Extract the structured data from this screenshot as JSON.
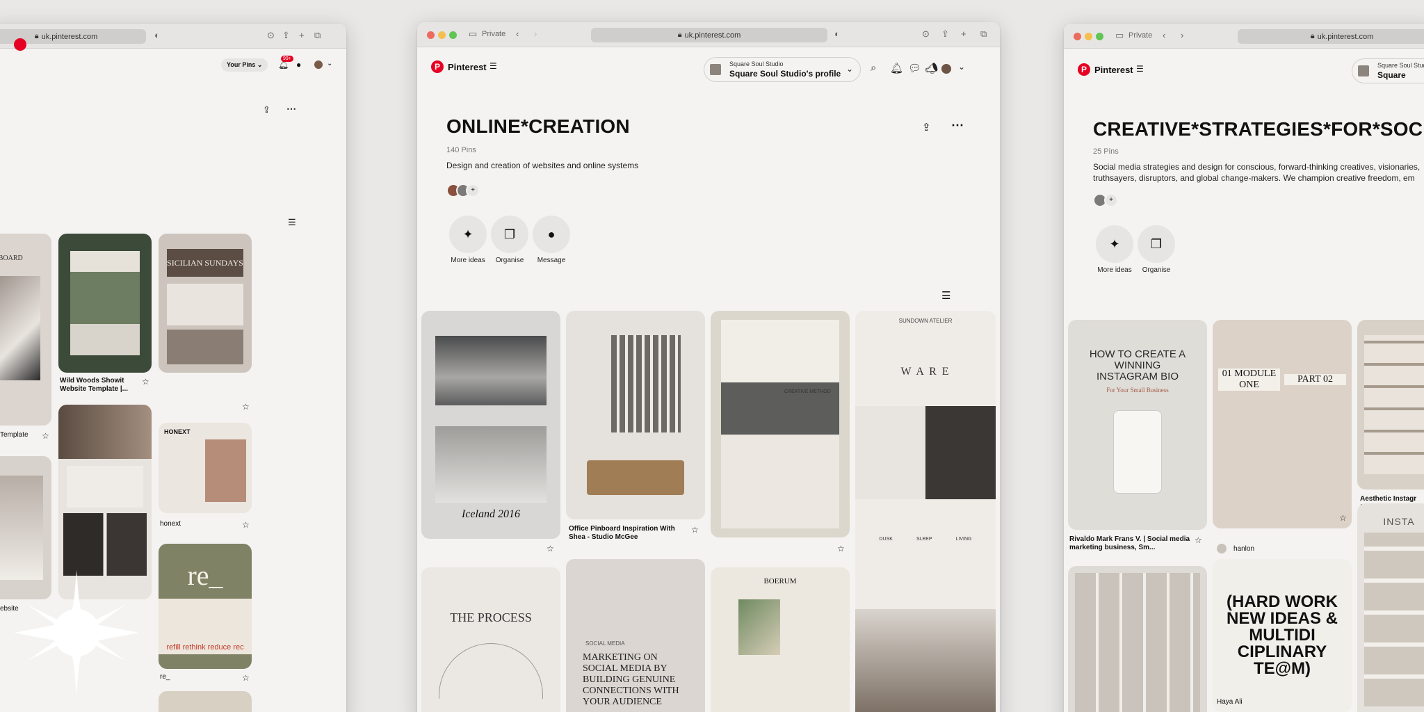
{
  "left_window": {
    "address": "uk.pinterest.com",
    "your_pins_label": "Your Pins",
    "notifications_badge": "99+",
    "captions": [
      "Wild Woods Showit Website Template |...",
      "honext",
      "re_",
      "Template",
      "ebsite"
    ],
    "card_texts": {
      "sicilian": "SICILIAN SUNDAYS",
      "board": "D BOARD",
      "honext": "HONEXT",
      "re": "re_",
      "re_tags": "refill rethink reduce rec"
    }
  },
  "center_window": {
    "private_label": "Private",
    "address": "uk.pinterest.com",
    "brand": "Pinterest",
    "profile_small": "Square Soul Studio",
    "profile_name": "Square Soul Studio's profile",
    "board_title": "ONLINE*CREATION",
    "pin_count": "140 Pins",
    "description": "Design and creation of websites and online systems",
    "actions": [
      {
        "label": "More ideas",
        "icon": "✦"
      },
      {
        "label": "Organise",
        "icon": "❐"
      },
      {
        "label": "Message",
        "icon": "●"
      }
    ],
    "captions": {
      "pinboard": "Office Pinboard Inspiration With Shea - Studio McGee"
    },
    "card_texts": {
      "iceland": "Iceland 2016",
      "ware": "W A R E",
      "sundown": "SUNDOWN ATELIER",
      "ware_items": [
        "DUSK",
        "SLEEP",
        "LIVING"
      ],
      "process": "THE PROCESS",
      "marketing": "MARKETING ON SOCIAL MEDIA BY BUILDING GENUINE CONNECTIONS WITH YOUR AUDIENCE",
      "social": "SOCIAL MEDIA",
      "boerum": "BOERUM",
      "creative_method": "CREATIVE METHOD"
    }
  },
  "right_window": {
    "private_label": "Private",
    "address": "uk.pinterest.com",
    "brand": "Pinterest",
    "profile_small": "Square Soul Studio",
    "profile_name": "Square",
    "board_title": "CREATIVE*STRATEGIES*FOR*SOCIAL*",
    "pin_count": "25 Pins",
    "description": "Social media strategies and design for conscious, forward-thinking creatives, visionaries, truthsayers, disruptors, and global change-makers. We champion creative freedom, em",
    "actions": [
      {
        "label": "More ideas",
        "icon": "✦"
      },
      {
        "label": "Organise",
        "icon": "❐"
      }
    ],
    "captions": {
      "bio": "Rivaldo Mark Frans V. | Social media marketing business, Sm...",
      "aesthetic": "Aesthetic Instagr Social Media Temp",
      "hanlon": "hanlon",
      "haya": "Haya Ali"
    },
    "card_texts": {
      "bio_title": "HOW TO CREATE A WINNING INSTAGRAM BIO",
      "bio_sub": "For Your Small Business",
      "hard_work": "(HARD WORK NEW IDEAS & MULTIDI CIPLINARY TE@M)",
      "part": "PART 02",
      "module": "01 MODULE ONE",
      "insta": "INSTA"
    }
  }
}
